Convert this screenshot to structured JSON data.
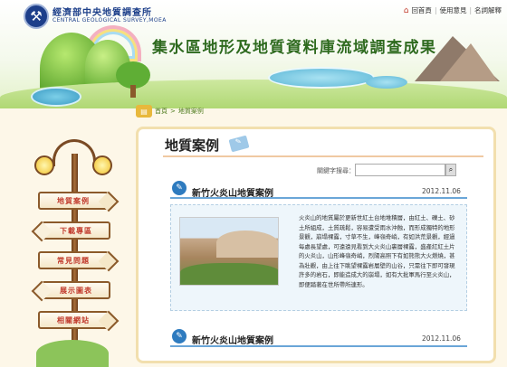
{
  "header": {
    "org_cn": "經濟部中央地質調查所",
    "org_en": "CENTRAL GEOLOGICAL SURVEY,MOEA",
    "site_title": "集水區地形及地質資料庫流域調查成果",
    "toplinks": [
      "回首頁",
      "使用意見",
      "名詞解釋"
    ]
  },
  "breadcrumb": [
    "首頁",
    "地質案例"
  ],
  "sidebar": {
    "items": [
      {
        "label": "地質案例",
        "side": "right"
      },
      {
        "label": "下載專區",
        "side": "left"
      },
      {
        "label": "常見問題",
        "side": "right"
      },
      {
        "label": "展示圖表",
        "side": "left"
      },
      {
        "label": "相關網站",
        "side": "right"
      }
    ]
  },
  "main": {
    "title": "地質案例",
    "search_label": "關鍵字搜尋：",
    "search_value": "",
    "articles": [
      {
        "title": "新竹火炎山地質案例",
        "date": "2012.11.06",
        "text": "火炎山的地質屬於更新世紅土台地堆積層，由紅土、礫土、砂土所組成，土質疏鬆，容易遭受雨水沖蝕，而形成獨特的地形景觀，崩塌裸露，寸草不生，峰嶺奇峭，有如洪荒景觀，經過每處長望處，可遠遠見看到大火炎山裏層裸露，盛產紅紅土片的火炎山，山形峰嶺奇峭，烈陽高照下有如熊熊大火燃燒，甚為壯觀，由上往下眺望裸露岩層壁的山谷，只需往下即可發現許多的岩石，即能造成大的崩塌，如有大批軍馬行至火炎山，即便踏著在世所帶所連形。"
      },
      {
        "title": "新竹火炎山地質案例",
        "date": "2012.11.06"
      }
    ]
  }
}
